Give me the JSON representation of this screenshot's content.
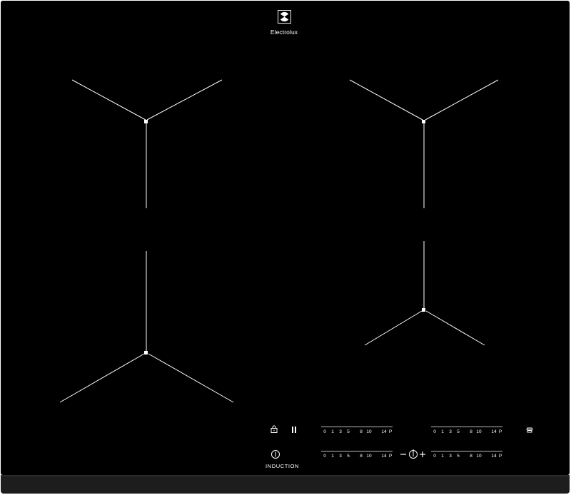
{
  "brand": {
    "name": "Electrolux"
  },
  "controls": {
    "induction_label": "INDUCTION",
    "slider_scale": [
      "0",
      "1",
      "3",
      "5",
      "8",
      "10",
      "14",
      "P"
    ]
  },
  "icons": {
    "lock": "lock-icon",
    "pause": "pause-icon",
    "power": "power-icon",
    "timer": "timer-icon",
    "minus": "minus-icon",
    "plus": "plus-icon",
    "hob2hood": "hob2hood-icon"
  },
  "colors": {
    "glass": "#000000",
    "frame": "#1d1d1d",
    "markings": "#ffffff"
  }
}
